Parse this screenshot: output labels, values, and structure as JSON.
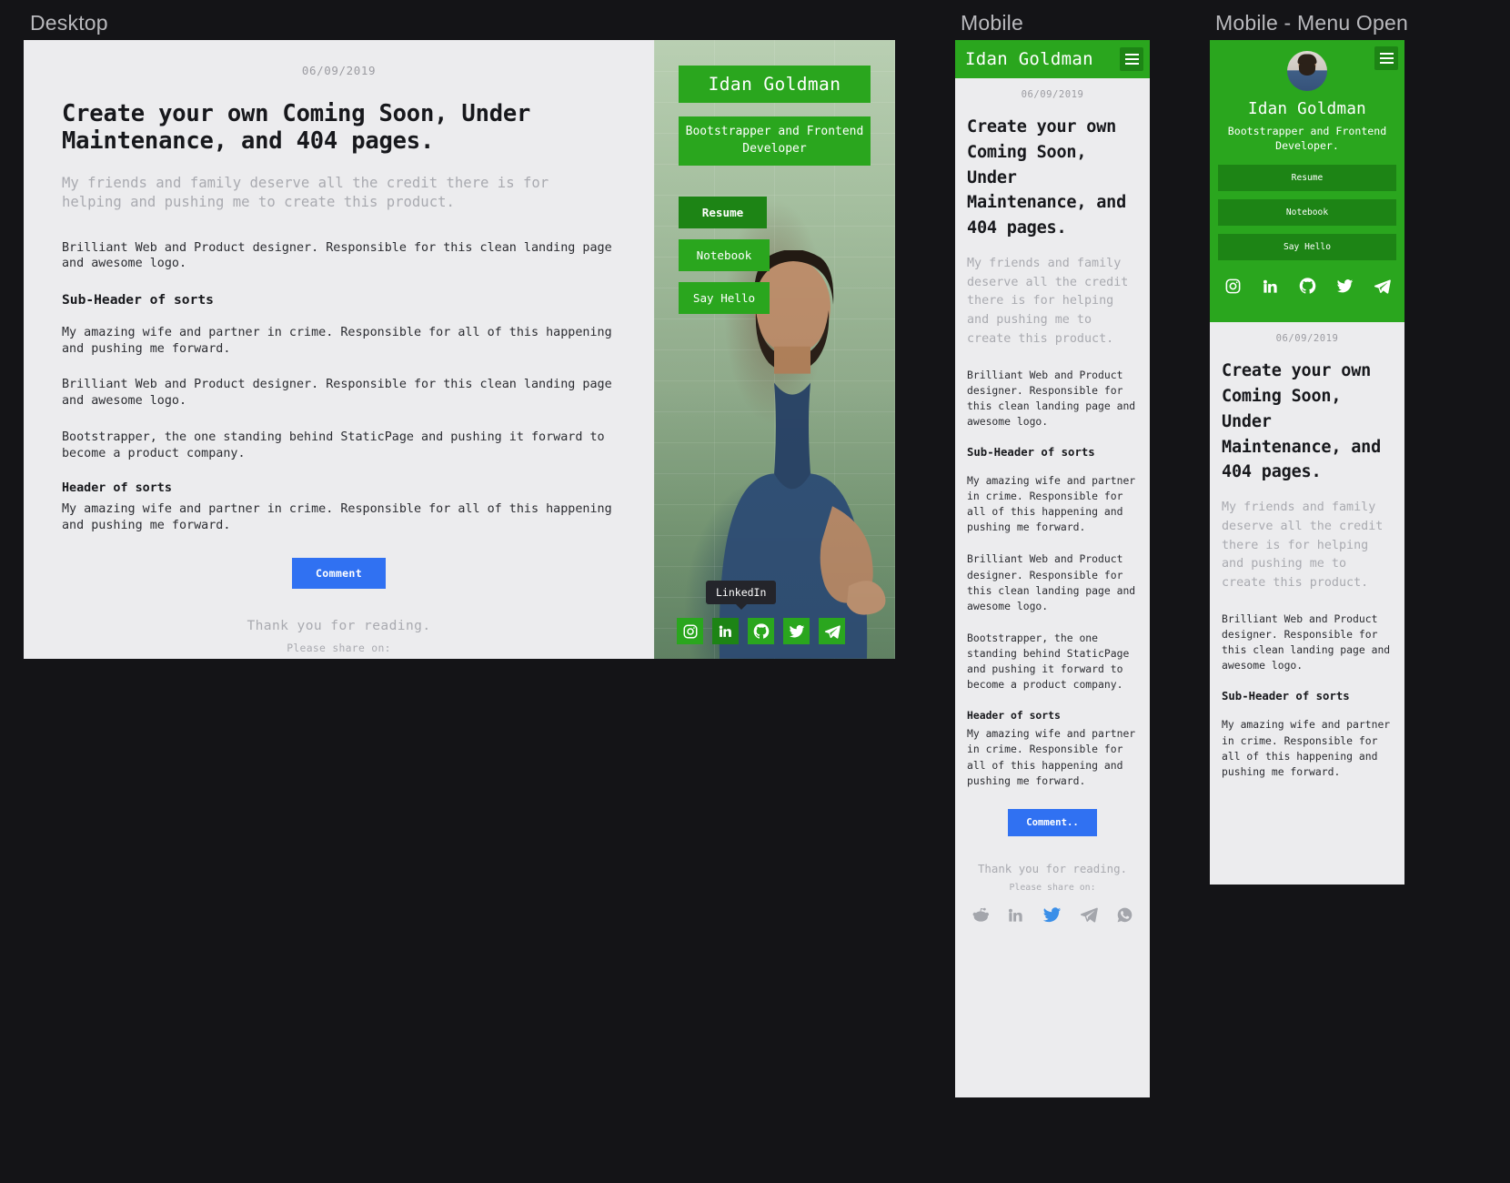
{
  "panels": {
    "desktop_caption": "Desktop",
    "mobile_caption": "Mobile",
    "mobile_menu_caption": "Mobile - Menu Open"
  },
  "colors": {
    "brand_green": "#2aa61e",
    "brand_green_dark": "#1d8415",
    "comment_blue": "#3071f2",
    "page_bg": "#ececee",
    "backdrop": "#141417",
    "muted_text": "#a9aab0",
    "twitter_blue": "#3b8fe8"
  },
  "article": {
    "date": "06/09/2019",
    "title": "Create your own Coming Soon, Under Maintenance, and 404 pages.",
    "lead": "My friends and family deserve all the credit there is for helping and pushing me to create this product.",
    "para1": "Brilliant Web and Product designer. Responsible for this clean landing page and awesome logo.",
    "subheader": "Sub-Header of sorts",
    "para2": "My amazing wife and partner in crime. Responsible for all of this happening and pushing me forward.",
    "para3": "Brilliant Web and Product designer. Responsible for this clean landing page and awesome logo.",
    "para4": "Bootstrapper, the one standing behind StaticPage and pushing it forward to become a product company.",
    "header": "Header of sorts",
    "para5": "My amazing wife and partner in crime. Responsible for all of this happening and pushing me forward.",
    "comment_label": "Comment",
    "comment_label_mobile": "Comment..",
    "thanks": "Thank you for reading.",
    "share_on": "Please share on:"
  },
  "share_icons": [
    {
      "name": "reddit-share-icon",
      "label": "Reddit"
    },
    {
      "name": "linkedin-share-icon",
      "label": "LinkedIn"
    },
    {
      "name": "twitter-share-icon",
      "label": "Twitter"
    },
    {
      "name": "telegram-share-icon",
      "label": "Telegram"
    },
    {
      "name": "whatsapp-share-icon",
      "label": "WhatsApp"
    }
  ],
  "profile": {
    "name": "Idan Goldman",
    "role": "Bootstrapper and Frontend Developer",
    "role_mobile": "Bootstrapper and Frontend Developer.",
    "nav": [
      {
        "label": "Resume",
        "active": true
      },
      {
        "label": "Notebook",
        "active": false
      },
      {
        "label": "Say Hello",
        "active": false
      }
    ],
    "tooltip": "LinkedIn",
    "social": [
      {
        "name": "instagram-icon",
        "label": "Instagram"
      },
      {
        "name": "linkedin-icon",
        "label": "LinkedIn"
      },
      {
        "name": "github-icon",
        "label": "GitHub"
      },
      {
        "name": "twitter-icon",
        "label": "Twitter"
      },
      {
        "name": "telegram-icon",
        "label": "Telegram"
      }
    ]
  }
}
